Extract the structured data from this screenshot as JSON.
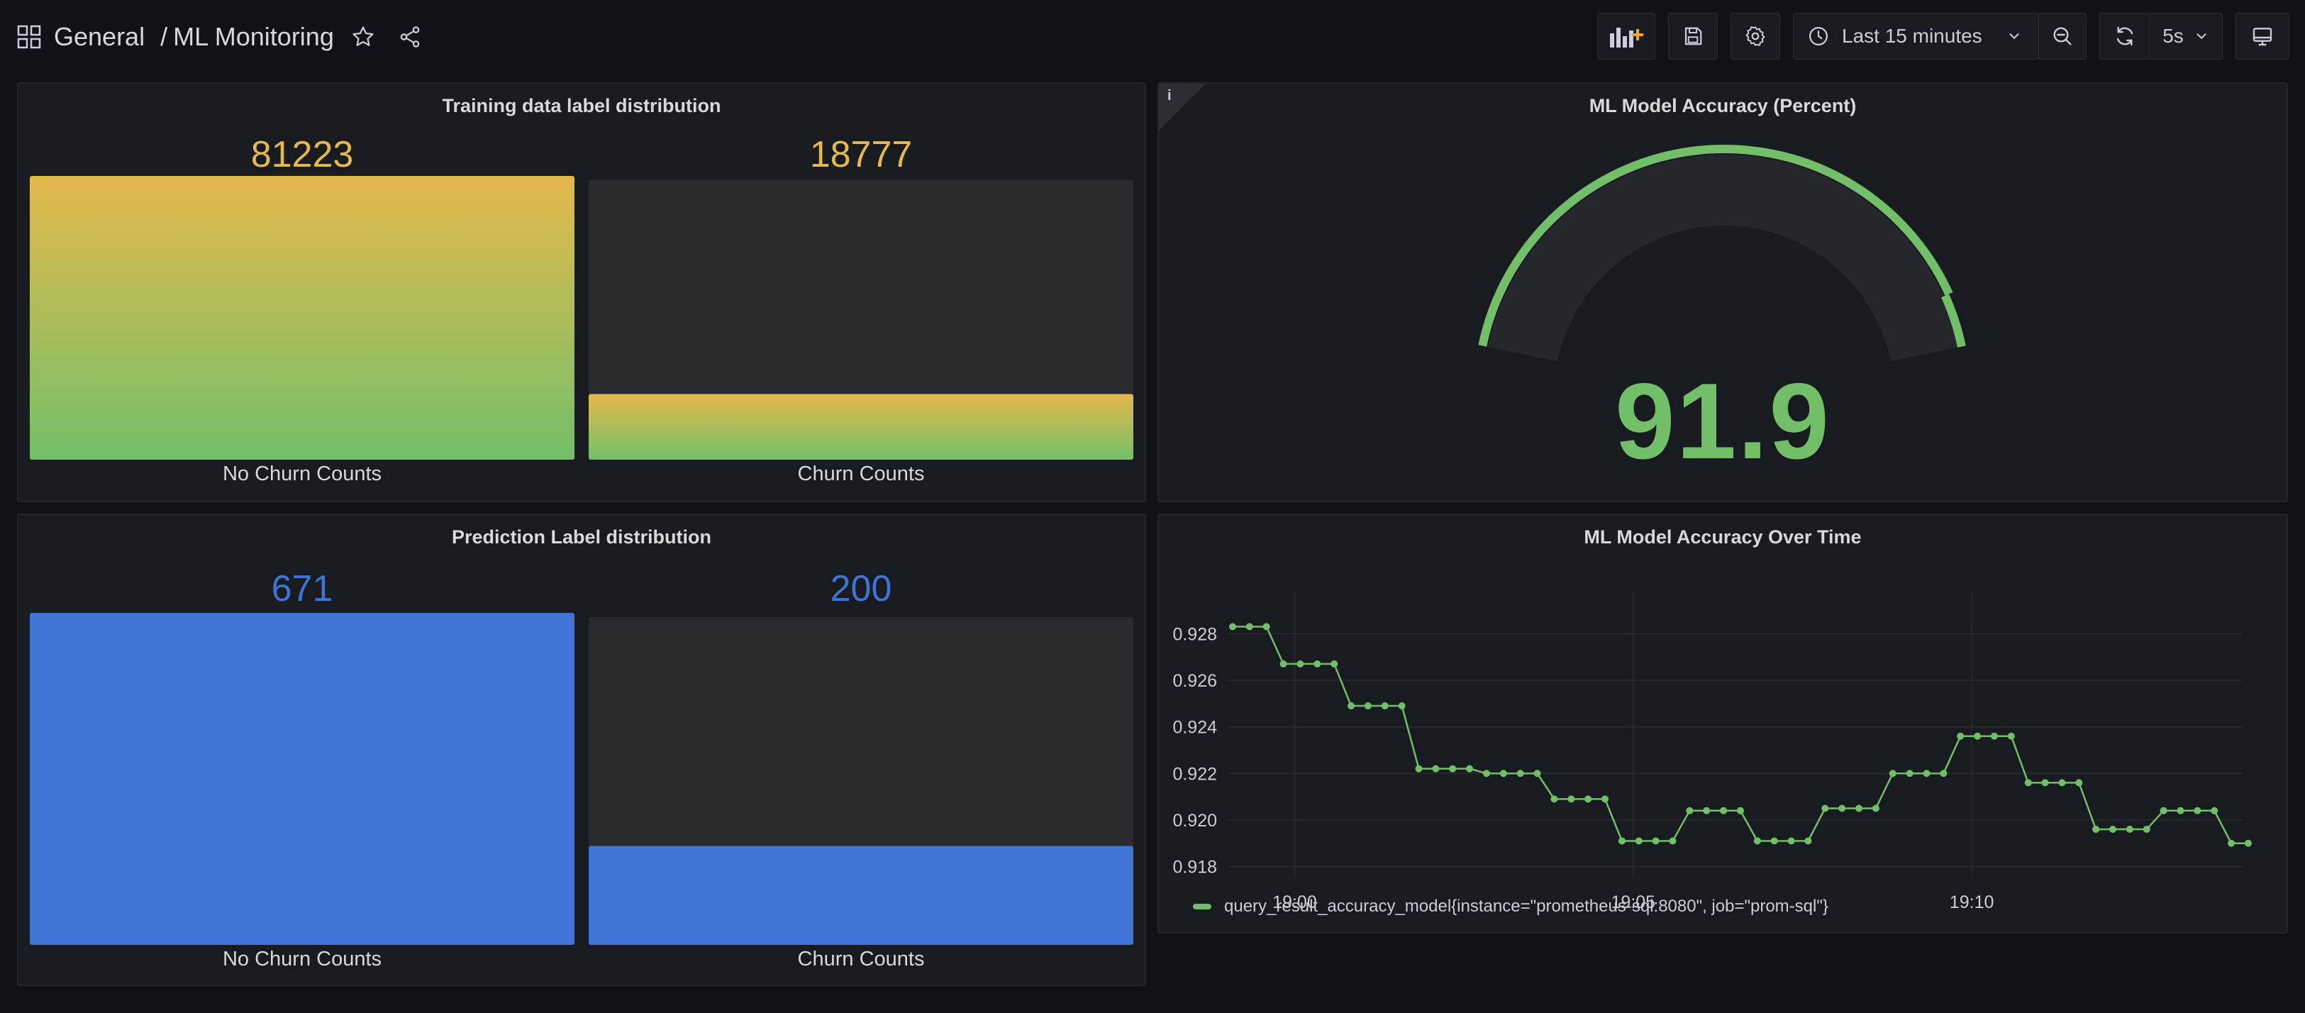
{
  "header": {
    "folder": "General",
    "separator": "/",
    "title": "ML Monitoring",
    "time_range": "Last 15 minutes",
    "refresh_interval": "5s"
  },
  "panels": {
    "training": {
      "title": "Training data label distribution",
      "bars": [
        {
          "label": "No Churn Counts",
          "value": "81223"
        },
        {
          "label": "Churn Counts",
          "value": "18777"
        }
      ]
    },
    "gauge": {
      "title": "ML Model Accuracy (Percent)",
      "info": "i",
      "value": "91.9"
    },
    "prediction": {
      "title": "Prediction Label distribution",
      "bars": [
        {
          "label": "No Churn Counts",
          "value": "671"
        },
        {
          "label": "Churn Counts",
          "value": "200"
        }
      ]
    },
    "timeseries": {
      "title": "ML Model Accuracy Over Time",
      "legend": "query_result_accuracy_model{instance=\"prometheus-sql:8080\", job=\"prom-sql\"}"
    }
  },
  "colors": {
    "background": "#111217",
    "panel": "#181b1f",
    "green": "#73bf69",
    "yellow": "#e5b94b",
    "blue": "#3f74d6",
    "series": "#73bf69"
  },
  "chart_data": [
    {
      "type": "bar",
      "categories": [
        "No Churn Counts",
        "Churn Counts"
      ],
      "values": [
        81223,
        18777
      ],
      "title": "Training data label distribution"
    },
    {
      "type": "bar",
      "categories": [
        "No Churn Counts",
        "Churn Counts"
      ],
      "values": [
        671,
        200
      ],
      "title": "Prediction Label distribution"
    },
    {
      "type": "line",
      "title": "ML Model Accuracy Over Time",
      "xlim": [
        "18:59",
        "19:14"
      ],
      "ylim": [
        0.9175,
        0.9295
      ],
      "x_ticks": [
        "19:00",
        "19:05",
        "19:10"
      ],
      "y_ticks": [
        "0.918",
        "0.920",
        "0.922",
        "0.924",
        "0.926",
        "0.928"
      ],
      "grid": true,
      "legend_position": "bottom-left",
      "series": [
        {
          "name": "query_result_accuracy_model{instance=\"prometheus-sql:8080\", job=\"prom-sql\"}",
          "points": [
            [
              "18:59:05",
              0.9283
            ],
            [
              "18:59:20",
              0.9283
            ],
            [
              "18:59:35",
              0.9283
            ],
            [
              "18:59:50",
              0.9267
            ],
            [
              "19:00:05",
              0.9267
            ],
            [
              "19:00:20",
              0.9267
            ],
            [
              "19:00:35",
              0.9267
            ],
            [
              "19:00:50",
              0.9249
            ],
            [
              "19:01:05",
              0.9249
            ],
            [
              "19:01:20",
              0.9249
            ],
            [
              "19:01:35",
              0.9249
            ],
            [
              "19:01:50",
              0.9222
            ],
            [
              "19:02:05",
              0.9222
            ],
            [
              "19:02:20",
              0.9222
            ],
            [
              "19:02:35",
              0.9222
            ],
            [
              "19:02:50",
              0.922
            ],
            [
              "19:03:05",
              0.922
            ],
            [
              "19:03:20",
              0.922
            ],
            [
              "19:03:35",
              0.922
            ],
            [
              "19:03:50",
              0.9209
            ],
            [
              "19:04:05",
              0.9209
            ],
            [
              "19:04:20",
              0.9209
            ],
            [
              "19:04:35",
              0.9209
            ],
            [
              "19:04:50",
              0.9191
            ],
            [
              "19:05:05",
              0.9191
            ],
            [
              "19:05:20",
              0.9191
            ],
            [
              "19:05:35",
              0.9191
            ],
            [
              "19:05:50",
              0.9204
            ],
            [
              "19:06:05",
              0.9204
            ],
            [
              "19:06:20",
              0.9204
            ],
            [
              "19:06:35",
              0.9204
            ],
            [
              "19:06:50",
              0.9191
            ],
            [
              "19:07:05",
              0.9191
            ],
            [
              "19:07:20",
              0.9191
            ],
            [
              "19:07:35",
              0.9191
            ],
            [
              "19:07:50",
              0.9205
            ],
            [
              "19:08:05",
              0.9205
            ],
            [
              "19:08:20",
              0.9205
            ],
            [
              "19:08:35",
              0.9205
            ],
            [
              "19:08:50",
              0.922
            ],
            [
              "19:09:05",
              0.922
            ],
            [
              "19:09:20",
              0.922
            ],
            [
              "19:09:35",
              0.922
            ],
            [
              "19:09:50",
              0.9236
            ],
            [
              "19:10:05",
              0.9236
            ],
            [
              "19:10:20",
              0.9236
            ],
            [
              "19:10:35",
              0.9236
            ],
            [
              "19:10:50",
              0.9216
            ],
            [
              "19:11:05",
              0.9216
            ],
            [
              "19:11:20",
              0.9216
            ],
            [
              "19:11:35",
              0.9216
            ],
            [
              "19:11:50",
              0.9196
            ],
            [
              "19:12:05",
              0.9196
            ],
            [
              "19:12:20",
              0.9196
            ],
            [
              "19:12:35",
              0.9196
            ],
            [
              "19:12:50",
              0.9204
            ],
            [
              "19:13:05",
              0.9204
            ],
            [
              "19:13:20",
              0.9204
            ],
            [
              "19:13:35",
              0.9204
            ],
            [
              "19:13:50",
              0.919
            ],
            [
              "19:14:05",
              0.919
            ]
          ]
        }
      ]
    },
    {
      "type": "gauge",
      "title": "ML Model Accuracy (Percent)",
      "value": 91.9,
      "min": 0,
      "max": 100
    }
  ]
}
